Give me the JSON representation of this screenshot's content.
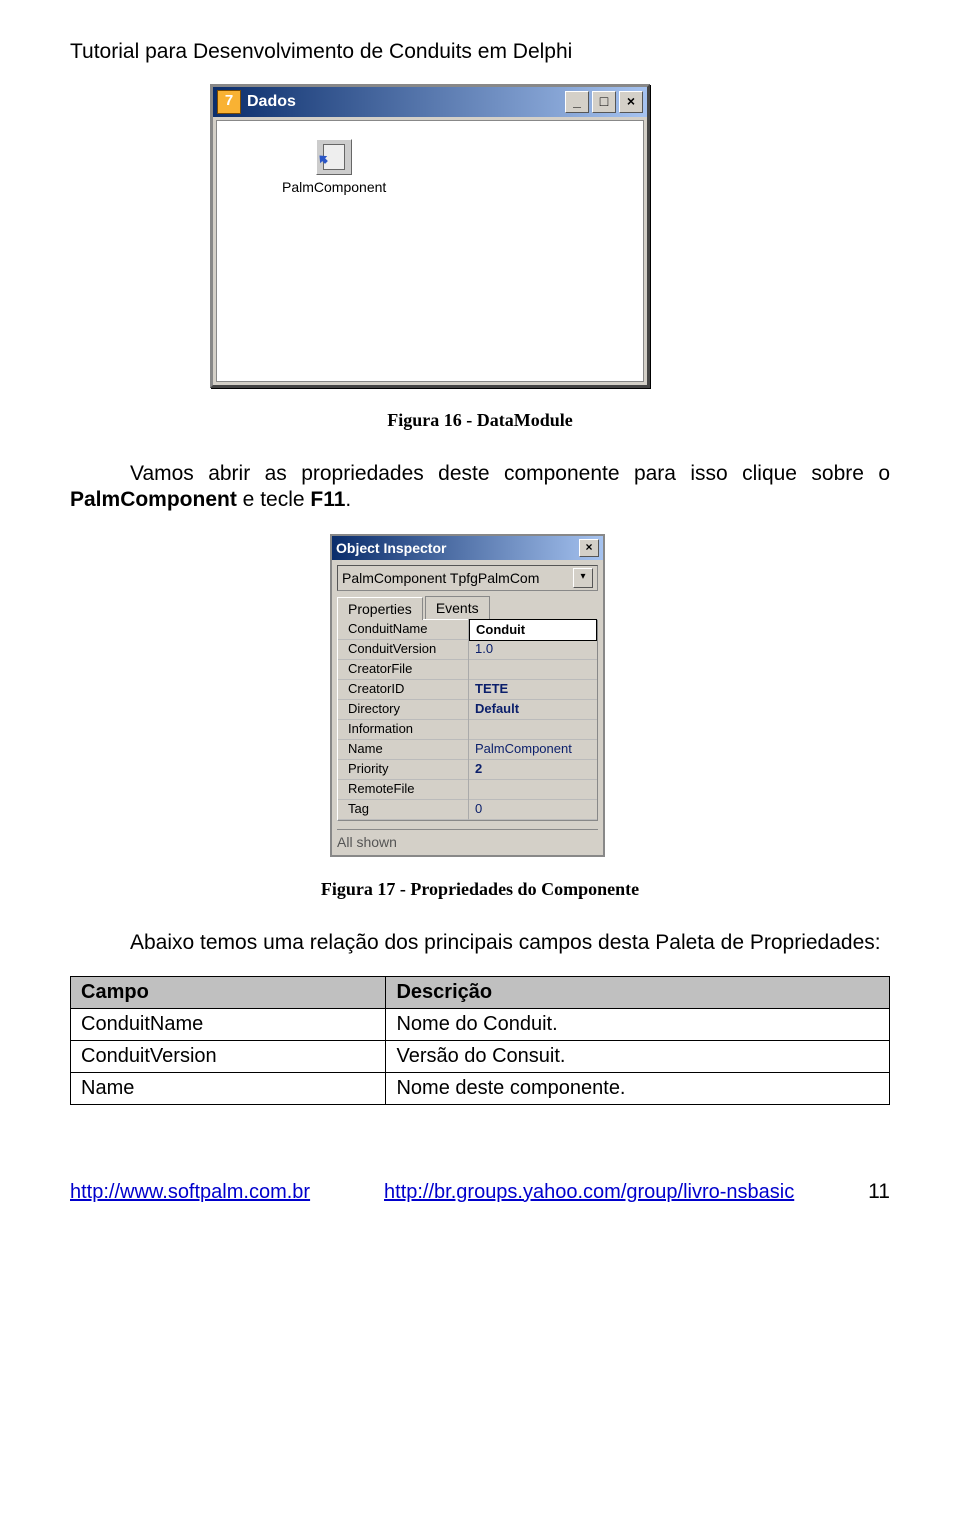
{
  "header": "Tutorial para Desenvolvimento de Conduits em Delphi",
  "fig1": {
    "title": "Dados",
    "iconGlyph": "7",
    "componentLabel": "PalmComponent",
    "caption": "Figura 16 - DataModule"
  },
  "para1_a": "Vamos abrir as propriedades deste componente para isso clique sobre o ",
  "para1_b": "PalmComponent",
  "para1_c": " e tecle ",
  "para1_d": "F11",
  "para1_e": ".",
  "inspector": {
    "title": "Object Inspector",
    "dropdown": "PalmComponent  TpfgPalmCom",
    "tabs": {
      "t0": "Properties",
      "t1": "Events"
    },
    "rows": [
      {
        "k": "ConduitName",
        "v": "Conduit",
        "selected": true
      },
      {
        "k": "ConduitVersion",
        "v": "1.0"
      },
      {
        "k": "CreatorFile",
        "v": ""
      },
      {
        "k": "CreatorID",
        "v": "TETE",
        "bold": true
      },
      {
        "k": "Directory",
        "v": "Default",
        "bold": true
      },
      {
        "k": "Information",
        "v": ""
      },
      {
        "k": "Name",
        "v": "PalmComponent"
      },
      {
        "k": "Priority",
        "v": "2",
        "bold": true
      },
      {
        "k": "RemoteFile",
        "v": ""
      },
      {
        "k": "Tag",
        "v": "0"
      }
    ],
    "footer": "All shown",
    "caption": "Figura 17 - Propriedades do Componente"
  },
  "para2": "Abaixo temos uma relação dos principais campos desta Paleta de Propriedades:",
  "table": {
    "h0": "Campo",
    "h1": "Descrição",
    "r0k": "ConduitName",
    "r0v": "Nome do Conduit.",
    "r1k": "ConduitVersion",
    "r1v": "Versão do Consuit.",
    "r2k": "Name",
    "r2v": "Nome deste componente."
  },
  "footer": {
    "link1": "http://www.softpalm.com.br",
    "link2": "http://br.groups.yahoo.com/group/livro-nsbasic",
    "pagenum": "11"
  }
}
